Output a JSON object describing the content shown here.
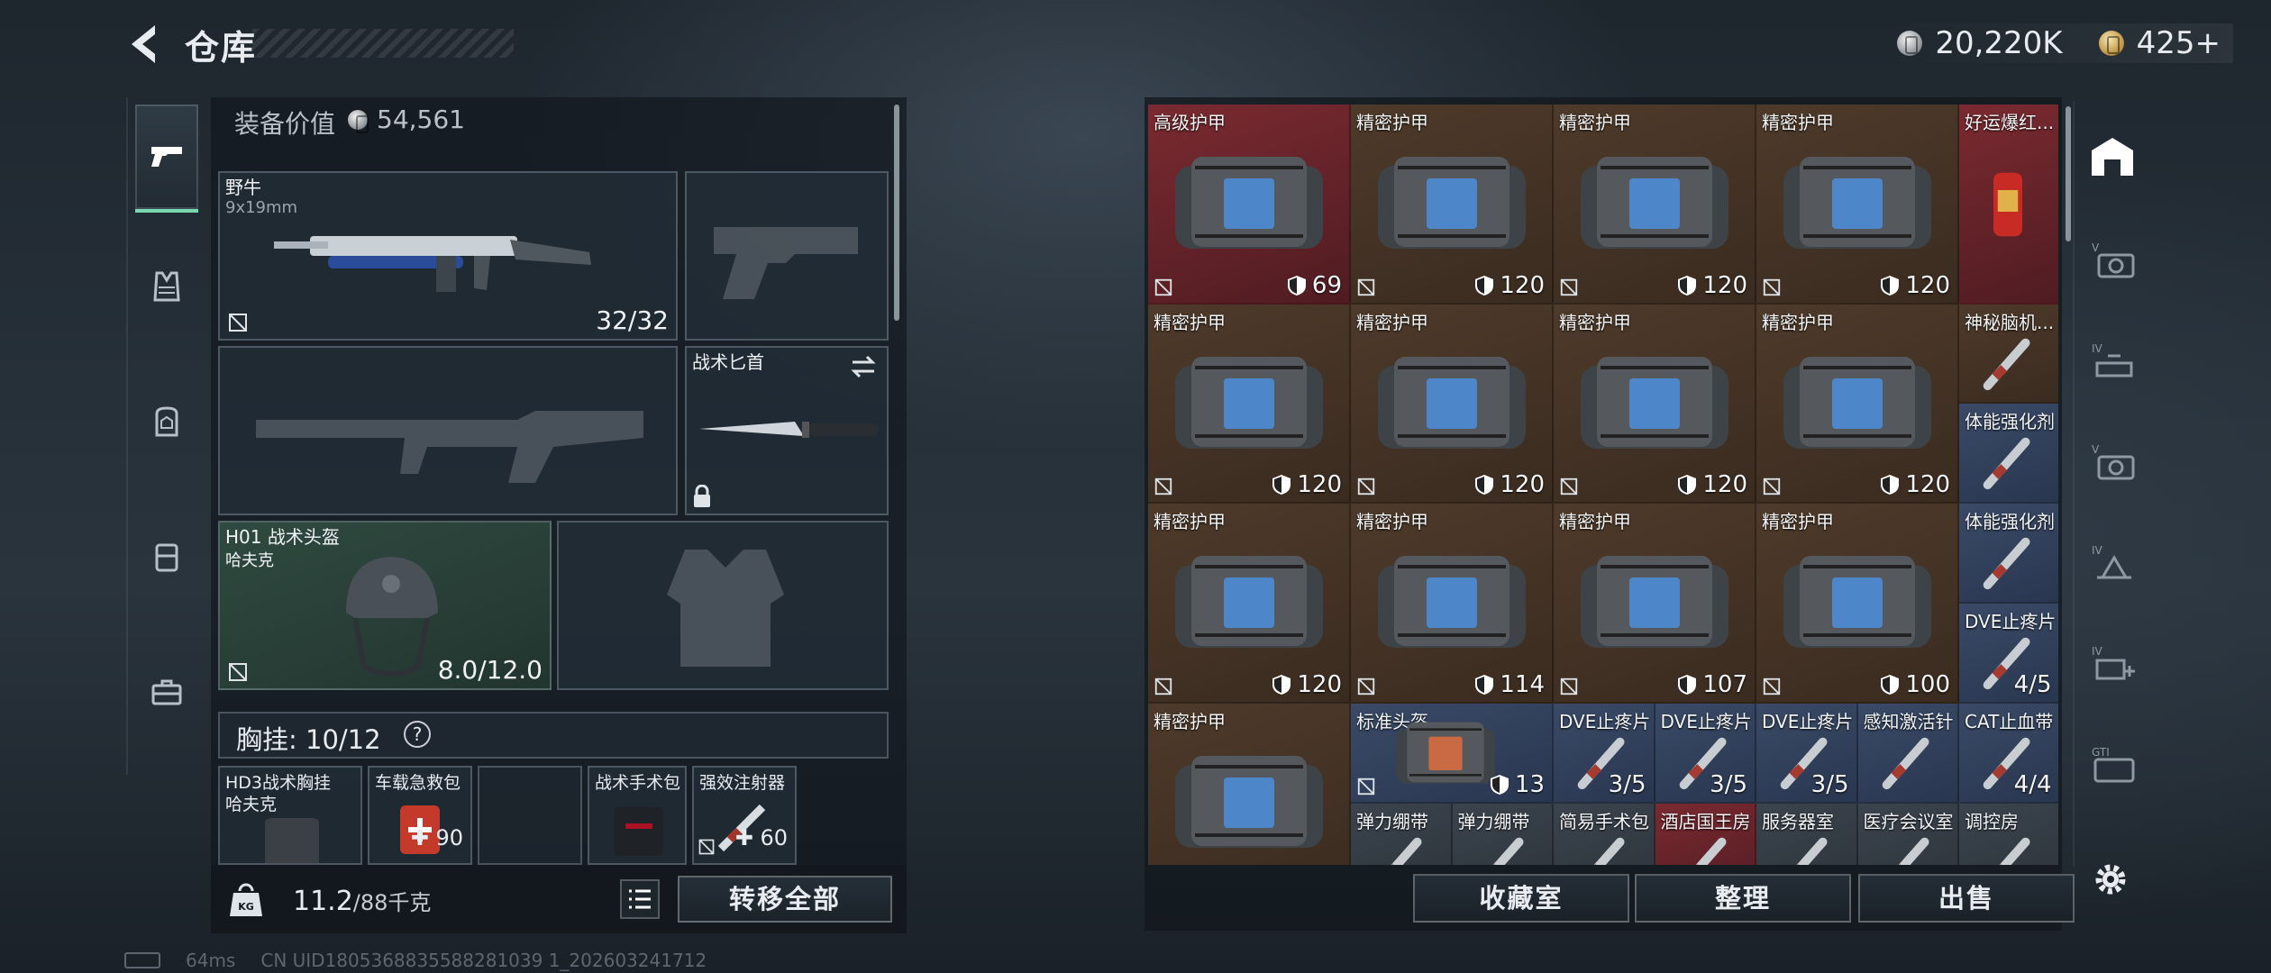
{
  "header": {
    "title": "仓库",
    "silver_amount": "20,220K",
    "gold_amount": "425+"
  },
  "loadout": {
    "equip_value_label": "装备价值",
    "equip_value": "54,561",
    "primary": {
      "name": "野牛",
      "caliber": "9x19mm",
      "ammo": "32/32"
    },
    "melee": {
      "name": "战术匕首"
    },
    "helmet": {
      "name": "H01 战术头盔",
      "brand": "哈夫克",
      "durability": "8.0/12.0"
    },
    "chest_rig": {
      "label": "胸挂:",
      "capacity": "10/12",
      "help": "?"
    },
    "rig_item": {
      "name": "HD3战术胸挂",
      "brand": "哈夫克"
    },
    "slots": [
      {
        "name": "车载急救包",
        "count": "90"
      },
      {
        "name": "",
        "count": ""
      },
      {
        "name": "战术手术包",
        "count": ""
      },
      {
        "name": "强效注射器",
        "count": "60"
      }
    ],
    "weight": "11.2",
    "weight_unit": "/88千克",
    "transfer_all": "转移全部"
  },
  "stash": {
    "items": [
      {
        "name": "高级护甲",
        "value": "69",
        "color": "red"
      },
      {
        "name": "精密护甲",
        "value": "120",
        "color": "brown"
      },
      {
        "name": "精密护甲",
        "value": "120",
        "color": "brown"
      },
      {
        "name": "精密护甲",
        "value": "120",
        "color": "brown"
      },
      {
        "name": "好运爆红...",
        "value": "",
        "color": "red"
      },
      {
        "name": "精密护甲",
        "value": "120",
        "color": "brown"
      },
      {
        "name": "精密护甲",
        "value": "120",
        "color": "brown"
      },
      {
        "name": "精密护甲",
        "value": "120",
        "color": "brown"
      },
      {
        "name": "精密护甲",
        "value": "120",
        "color": "brown"
      },
      {
        "name": "神秘脑机...",
        "value": "",
        "color": "brown"
      },
      {
        "name": "体能强化剂",
        "value": "",
        "color": "blue"
      },
      {
        "name": "精密护甲",
        "value": "120",
        "color": "brown"
      },
      {
        "name": "精密护甲",
        "value": "114",
        "color": "brown"
      },
      {
        "name": "精密护甲",
        "value": "107",
        "color": "brown"
      },
      {
        "name": "精密护甲",
        "value": "100",
        "color": "brown"
      },
      {
        "name": "体能强化剂",
        "value": "",
        "color": "blue"
      },
      {
        "name": "DVE止疼片",
        "value": "4/5",
        "color": "blue"
      },
      {
        "name": "精密护甲",
        "value": "",
        "color": "brown"
      },
      {
        "name": "标准头盔",
        "value": "13",
        "color": "blue"
      },
      {
        "name": "DVE止疼片",
        "value": "3/5",
        "color": "blue"
      },
      {
        "name": "DVE止疼片",
        "value": "3/5",
        "color": "blue"
      },
      {
        "name": "DVE止疼片",
        "value": "3/5",
        "color": "blue"
      },
      {
        "name": "感知激活针",
        "value": "",
        "color": "blue"
      },
      {
        "name": "CAT止血带",
        "value": "4/4",
        "color": "blue"
      },
      {
        "name": "弹力绷带",
        "value": "",
        "color": "gray"
      },
      {
        "name": "弹力绷带",
        "value": "",
        "color": "gray"
      },
      {
        "name": "简易手术包",
        "value": "",
        "color": "gray"
      },
      {
        "name": "酒店国王房",
        "value": "",
        "color": "red"
      },
      {
        "name": "服务器室",
        "value": "",
        "color": "gray"
      },
      {
        "name": "医疗会议室",
        "value": "",
        "color": "gray"
      },
      {
        "name": "调控房",
        "value": "",
        "color": "gray"
      }
    ]
  },
  "right_tabs": {
    "labels": [
      "V",
      "IV",
      "V",
      "IV",
      "IV",
      "GTI"
    ]
  },
  "actions": {
    "collection": "收藏室",
    "organize": "整理",
    "sell": "出售"
  },
  "status": {
    "ping": "64ms",
    "uid": "CN UID1805368835588281039 1_202603241712"
  },
  "colors": {
    "accent": "#79d8b0",
    "red_cell": "#7a2a30",
    "brown_cell": "#4e3a2a",
    "blue_cell": "#3a4a66"
  }
}
